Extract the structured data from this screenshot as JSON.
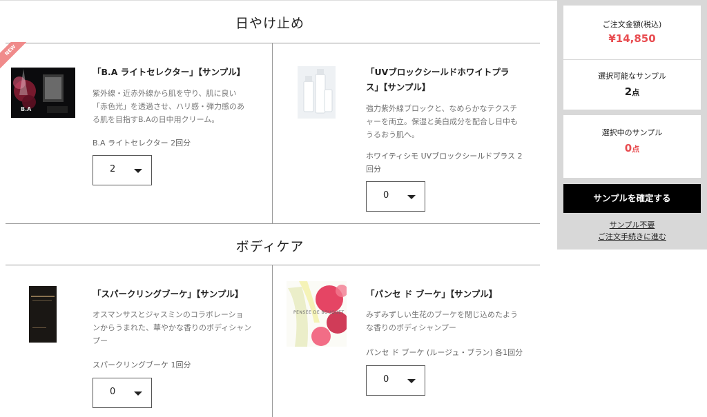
{
  "sections": [
    {
      "title": "日やけ止め",
      "products": [
        {
          "name": "「B.A ライトセレクター」【サンプル】",
          "description_lines": [
            "紫外線・近赤外線から肌を守り、肌に良い",
            "「赤色光」を透過させ、ハリ感・弾力感のあ",
            "る肌を目指すB.Aの日中用クリーム。"
          ],
          "note_lines": [
            "B.A ライトセレクター 2回分"
          ],
          "quantity": "2",
          "badge": "NEW",
          "thumb_label": "B.A"
        },
        {
          "name_lines": [
            "「UVブロックシールドホワイトプラ",
            "ス」【サンプル】"
          ],
          "description_lines": [
            "強力紫外線ブロックと、なめらかなテクスチ",
            "ャーを両立。保湿と美白成分を配合し日中も",
            "うるおう肌へ。"
          ],
          "note_lines": [
            "ホワイティシモ UVブロックシールドプラス 2",
            "回分"
          ],
          "quantity": "0"
        }
      ]
    },
    {
      "title": "ボディケア",
      "products": [
        {
          "name": "「スパークリングブーケ」【サンプル】",
          "description_lines": [
            "オスマンサスとジャスミンのコラボレーショ",
            "ンからうまれた、華やかな香りのボディシャン",
            "プー"
          ],
          "note_lines": [
            "スパークリングブーケ 1回分"
          ],
          "quantity": "0"
        },
        {
          "name": "「パンセ ド ブーケ」【サンプル】",
          "description_lines": [
            "みずみずしい生花のブーケを閉じ込めたよう",
            "な香りのボディシャンプー"
          ],
          "note_lines": [
            "パンセ ド ブーケ (ルージュ・ブラン) 各1回分"
          ],
          "quantity": "0",
          "thumb_label": "PENSÉE DE BOUQUET"
        }
      ]
    }
  ],
  "summary": {
    "total_label": "ご注文金額(税込)",
    "total_value": "¥14,850",
    "available_label": "選択可能なサンプル",
    "available_value": "2",
    "available_unit": "点",
    "selected_label": "選択中のサンプル",
    "selected_value": "0",
    "selected_unit": "点",
    "confirm_label": "サンプルを確定する",
    "skip_line1": "サンプル不要",
    "skip_line2": "ご注文手続きに進む"
  },
  "colors": {
    "accent_red": "#e84c50",
    "badge_pink": "#f08b8b",
    "button_black": "#000000",
    "sidebar_gray": "#d8d8d8"
  }
}
